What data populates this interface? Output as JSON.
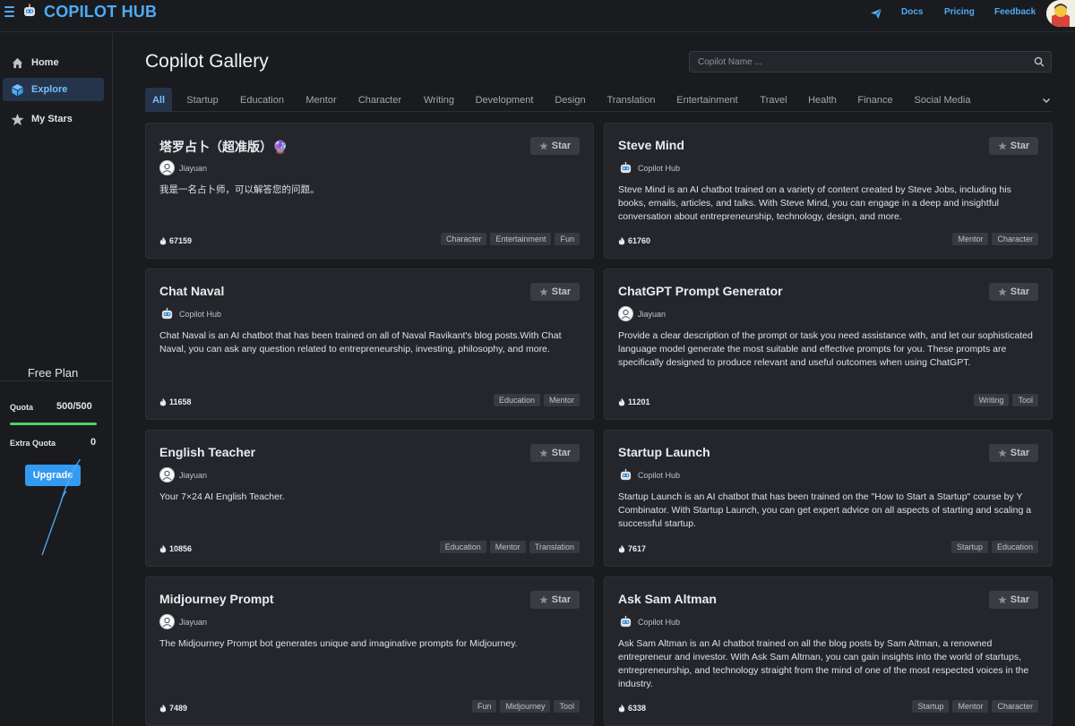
{
  "header": {
    "brand": "COPILOT HUB",
    "links": [
      "Docs",
      "Pricing",
      "Feedback"
    ]
  },
  "sidebar": {
    "items": [
      {
        "label": "Home",
        "icon": "home-icon"
      },
      {
        "label": "Explore",
        "icon": "cube-icon"
      },
      {
        "label": "My Stars",
        "icon": "star-icon"
      }
    ],
    "plan": {
      "title": "Free Plan",
      "quota_label": "Quota",
      "quota_value": "500/500",
      "quota_fraction": 1.0,
      "extra_label": "Extra Quota",
      "extra_value": "0",
      "upgrade_label": "Upgrade"
    }
  },
  "main": {
    "title": "Copilot Gallery",
    "search_placeholder": "Copilot Name ...",
    "tabs": [
      "All",
      "Startup",
      "Education",
      "Mentor",
      "Character",
      "Writing",
      "Development",
      "Design",
      "Translation",
      "Entertainment",
      "Travel",
      "Health",
      "Finance",
      "Social Media"
    ],
    "active_tab": "All"
  },
  "star_label": "Star",
  "cards": [
    {
      "title": "塔罗占卜（超准版）🔮",
      "author": "Jiayuan",
      "avatar": "person",
      "description": "我是一名占卜师，可以解答您的问题。",
      "count": "67159",
      "tags": [
        "Character",
        "Entertainment",
        "Fun"
      ]
    },
    {
      "title": "Steve Mind",
      "author": "Copilot Hub",
      "avatar": "robot",
      "description": "Steve Mind is an AI chatbot trained on a variety of content created by Steve Jobs, including his books, emails, articles, and talks. With Steve Mind, you can engage in a deep and insightful conversation about entrepreneurship, technology, design, and more.",
      "count": "61760",
      "tags": [
        "Mentor",
        "Character"
      ]
    },
    {
      "title": "Chat Naval",
      "author": "Copilot Hub",
      "avatar": "robot",
      "description": "Chat Naval is an AI chatbot that has been trained on all of Naval Ravikant's blog posts.With Chat Naval, you can ask any question related to entrepreneurship, investing, philosophy, and more.",
      "count": "11658",
      "tags": [
        "Education",
        "Mentor"
      ]
    },
    {
      "title": "ChatGPT Prompt Generator",
      "author": "Jiayuan",
      "avatar": "person",
      "description": "Provide a clear description of the prompt or task you need assistance with, and let our sophisticated language model generate the most suitable and effective prompts for you. These prompts are specifically designed to produce relevant and useful outcomes when using ChatGPT.",
      "count": "11201",
      "tags": [
        "Writing",
        "Tool"
      ]
    },
    {
      "title": "English Teacher",
      "author": "Jiayuan",
      "avatar": "person",
      "description": "Your 7×24 AI English Teacher.",
      "count": "10856",
      "tags": [
        "Education",
        "Mentor",
        "Translation"
      ]
    },
    {
      "title": "Startup Launch",
      "author": "Copilot Hub",
      "avatar": "robot",
      "description": "Startup Launch is an AI chatbot that has been trained on the \"How to Start a Startup\" course by Y Combinator. With Startup Launch, you can get expert advice on all aspects of starting and scaling a successful startup.",
      "count": "7617",
      "tags": [
        "Startup",
        "Education"
      ]
    },
    {
      "title": "Midjourney Prompt",
      "author": "Jiayuan",
      "avatar": "person",
      "description": "The Midjourney Prompt bot generates unique and imaginative prompts for Midjourney.",
      "count": "7489",
      "tags": [
        "Fun",
        "Midjourney",
        "Tool"
      ]
    },
    {
      "title": "Ask Sam Altman",
      "author": "Copilot Hub",
      "avatar": "robot",
      "description": "Ask Sam Altman is an AI chatbot trained on all the blog posts by Sam Altman, a renowned entrepreneur and investor. With Ask Sam Altman, you can gain insights into the world of startups, entrepreneurship, and technology straight from the mind of one of the most respected voices in the industry.",
      "count": "6338",
      "tags": [
        "Startup",
        "Mentor",
        "Character"
      ]
    }
  ],
  "colors": {
    "accent": "#4dabf7",
    "background": "#1a1b1e",
    "card": "#25262b",
    "quota_bar": "#51cf66",
    "upgrade": "#339af0"
  }
}
